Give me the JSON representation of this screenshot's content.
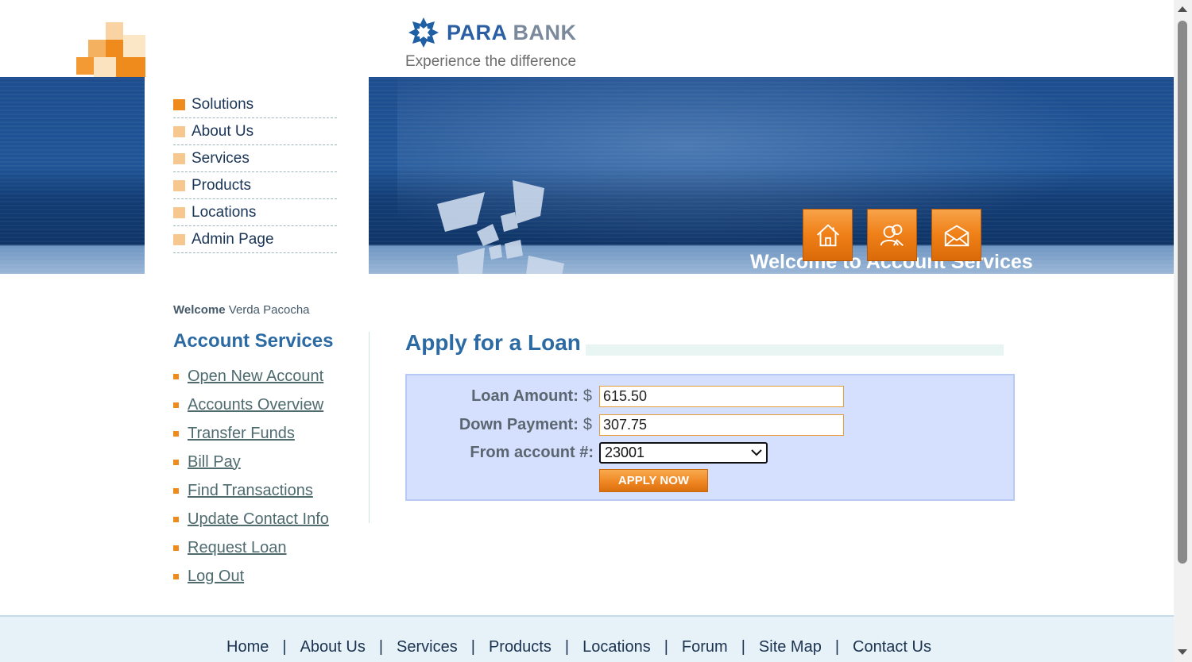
{
  "header": {
    "brand_para": "PARA",
    "brand_bank": "BANK",
    "tagline": "Experience the difference"
  },
  "banner": {
    "welcome": "Welcome to Account Services",
    "icons": [
      "home-icon",
      "contact-icon",
      "mail-icon"
    ]
  },
  "top_menu": {
    "items": [
      {
        "label": "Solutions",
        "active": true
      },
      {
        "label": "About Us"
      },
      {
        "label": "Services"
      },
      {
        "label": "Products"
      },
      {
        "label": "Locations"
      },
      {
        "label": "Admin Page"
      }
    ]
  },
  "account_panel": {
    "welcome_prefix": "Welcome",
    "user_name": "Verda Pacocha",
    "title": "Account Services",
    "links": [
      "Open New Account",
      "Accounts Overview",
      "Transfer Funds",
      "Bill Pay",
      "Find Transactions",
      "Update Contact Info",
      "Request Loan",
      "Log Out"
    ]
  },
  "main": {
    "title": "Apply for a Loan",
    "loan_amount_label": "Loan Amount:",
    "loan_amount_currency": "$",
    "loan_amount_value": "615.50",
    "down_payment_label": "Down Payment:",
    "down_payment_currency": "$",
    "down_payment_value": "307.75",
    "from_account_label": "From account #:",
    "from_account_value": "23001",
    "apply_button": "APPLY NOW"
  },
  "footer": {
    "links": [
      "Home",
      "About Us",
      "Services",
      "Products",
      "Locations",
      "Forum",
      "Site Map",
      "Contact Us"
    ],
    "separator": "|"
  },
  "colors": {
    "accent_orange": "#ef8a1c",
    "title_blue": "#2c6aa3",
    "banner_blue": "#1f5597",
    "form_bg": "#d4e0fd"
  }
}
